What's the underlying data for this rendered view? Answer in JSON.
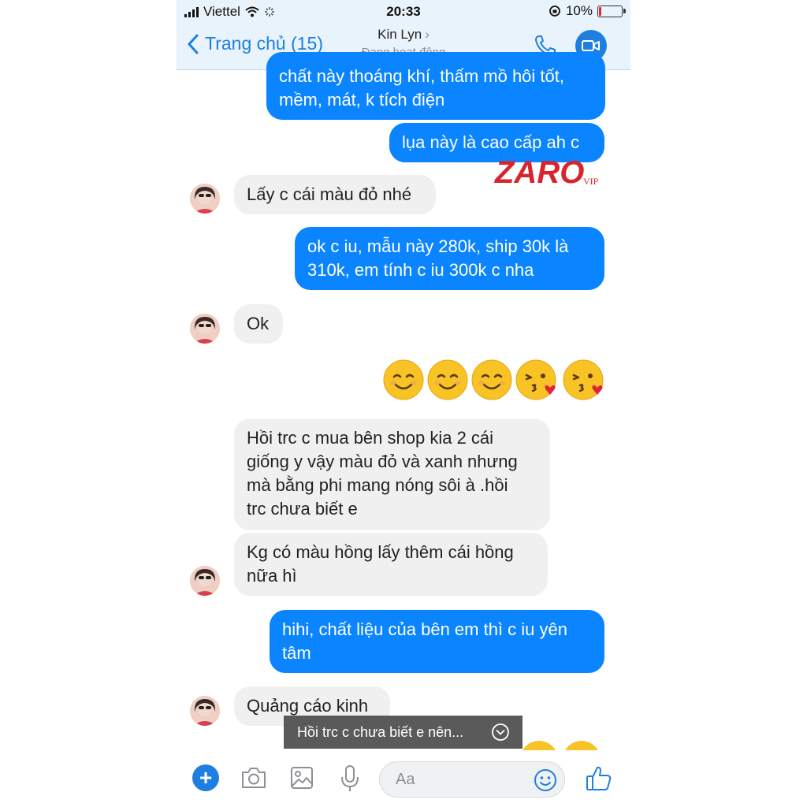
{
  "status_bar": {
    "carrier": "Viettel",
    "time": "20:33",
    "battery": "10%",
    "battery_level": 0.1
  },
  "nav": {
    "back_label": "Trang chủ (15)",
    "contact_name": "Kin Lyn",
    "contact_status": "Đang hoạt động"
  },
  "watermark": {
    "brand": "ZARO",
    "tag": "VIP",
    "color": "#d9232d"
  },
  "messages": [
    {
      "side": "out",
      "lines": [
        "chất này thoáng khí, thấm mồ hôi tốt,",
        "mềm, mát, k tích điện"
      ]
    },
    {
      "side": "out",
      "lines": [
        "lụa này là cao cấp ah c"
      ]
    },
    {
      "side": "in",
      "lines": [
        "Lấy c cái màu đỏ nhé"
      ]
    },
    {
      "side": "out",
      "lines": [
        "ok c iu, mẫu này 280k, ship 30k là",
        "310k, em tính c iu 300k c nha"
      ]
    },
    {
      "side": "in",
      "lines": [
        "Ok"
      ]
    },
    {
      "side": "out",
      "emoji": [
        "relieved-smile",
        "relieved-smile",
        "relieved-smile",
        "kissing-heart",
        "kissing-heart"
      ]
    },
    {
      "side": "in",
      "lines": [
        "Hồi trc c mua bên shop kia 2 cái",
        "giống y vậy màu đỏ và xanh nhưng",
        "mà bằng phi mang nóng sôi à .hồi",
        "trc chưa biết e"
      ]
    },
    {
      "side": "in",
      "lines": [
        "Kg có màu hồng lấy thêm cái hồng",
        "nữa hì"
      ]
    },
    {
      "side": "out",
      "lines": [
        "hihi, chất liệu của bên em thì c iu yên",
        "tâm"
      ]
    },
    {
      "side": "in",
      "lines": [
        "Quảng cáo kinh"
      ]
    }
  ],
  "new_message_toast": "Hồi trc c chưa biết e nên...",
  "composer": {
    "placeholder": "Aa"
  },
  "colors": {
    "accent": "#1e7fe0",
    "outgoing_bubble": "#0a84ff",
    "incoming_bubble": "#f0f0f0"
  }
}
